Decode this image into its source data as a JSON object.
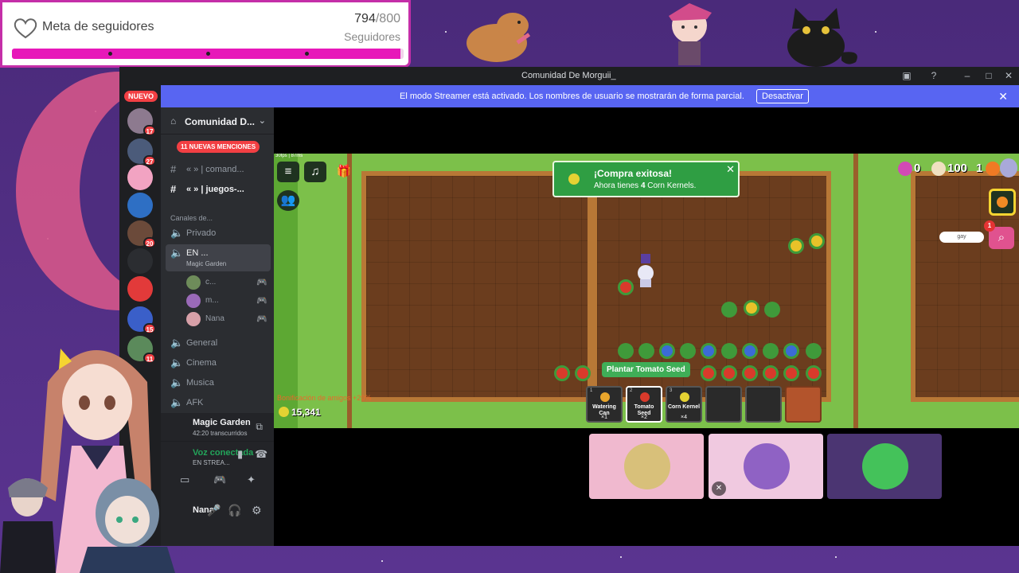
{
  "goal": {
    "title": "Meta de seguidores",
    "current": "794",
    "total": "/800",
    "subtitle": "Seguidores",
    "progress_fraction": 0.9925
  },
  "window": {
    "title": "Comunidad De Morguii_"
  },
  "streamer": {
    "message": "El modo Streamer está activado. Los nombres de usuario se mostrarán de forma parcial.",
    "button": "Desactivar"
  },
  "servers": {
    "new_badge": "NUEVO",
    "badges": [
      "17",
      "27",
      "20",
      "15",
      "11"
    ]
  },
  "guild": {
    "name": "Comunidad D...",
    "mentions": "11 NUEVAS MENCIONES"
  },
  "channels": {
    "text1": "« » | comand...",
    "text2": "« » | juegos-...",
    "category": "Canales de...",
    "voice_privado": "Privado",
    "voice_active": "EN ...",
    "voice_active_sub": "Magic Garden",
    "members": [
      "c...",
      "m...",
      "Nana"
    ],
    "voice_general": "General",
    "voice_cinema": "Cinema",
    "voice_musica": "Musica",
    "voice_afk": "AFK"
  },
  "panel": {
    "activity_title": "Magic Garden",
    "activity_time": "42:20 transcurridos",
    "voice_connected": "Voz conectada",
    "voice_channel": "EN STREA...",
    "username": "Nana"
  },
  "game": {
    "fps": "30fps | 87ms",
    "toast_title": "¡Compra exitosa!",
    "toast_body_pre": "Ahora tienes ",
    "toast_body_num": "4",
    "toast_body_post": " Corn Kernels.",
    "stat_a": "0",
    "stat_b": "100",
    "stat_c": "1",
    "chat_search": "gay",
    "chat_badge": "1",
    "prompt": "Plantar Tomato Seed",
    "bonus": "Bonificación de amigos +20%",
    "balance": "15,341",
    "slots": [
      {
        "n": "1",
        "label": "Watering Can",
        "qty": "×1",
        "color": "#e8a52c"
      },
      {
        "n": "2",
        "label": "Tomato Seed",
        "qty": "×2",
        "color": "#d93a2b"
      },
      {
        "n": "3",
        "label": "Corn Kernel",
        "qty": "×4",
        "color": "#e5d233"
      }
    ]
  },
  "colors": {
    "accent": "#5865f2",
    "goal_fill": "#e718b9",
    "voice_green": "#23a55a",
    "toast_green": "#2f9e43"
  }
}
